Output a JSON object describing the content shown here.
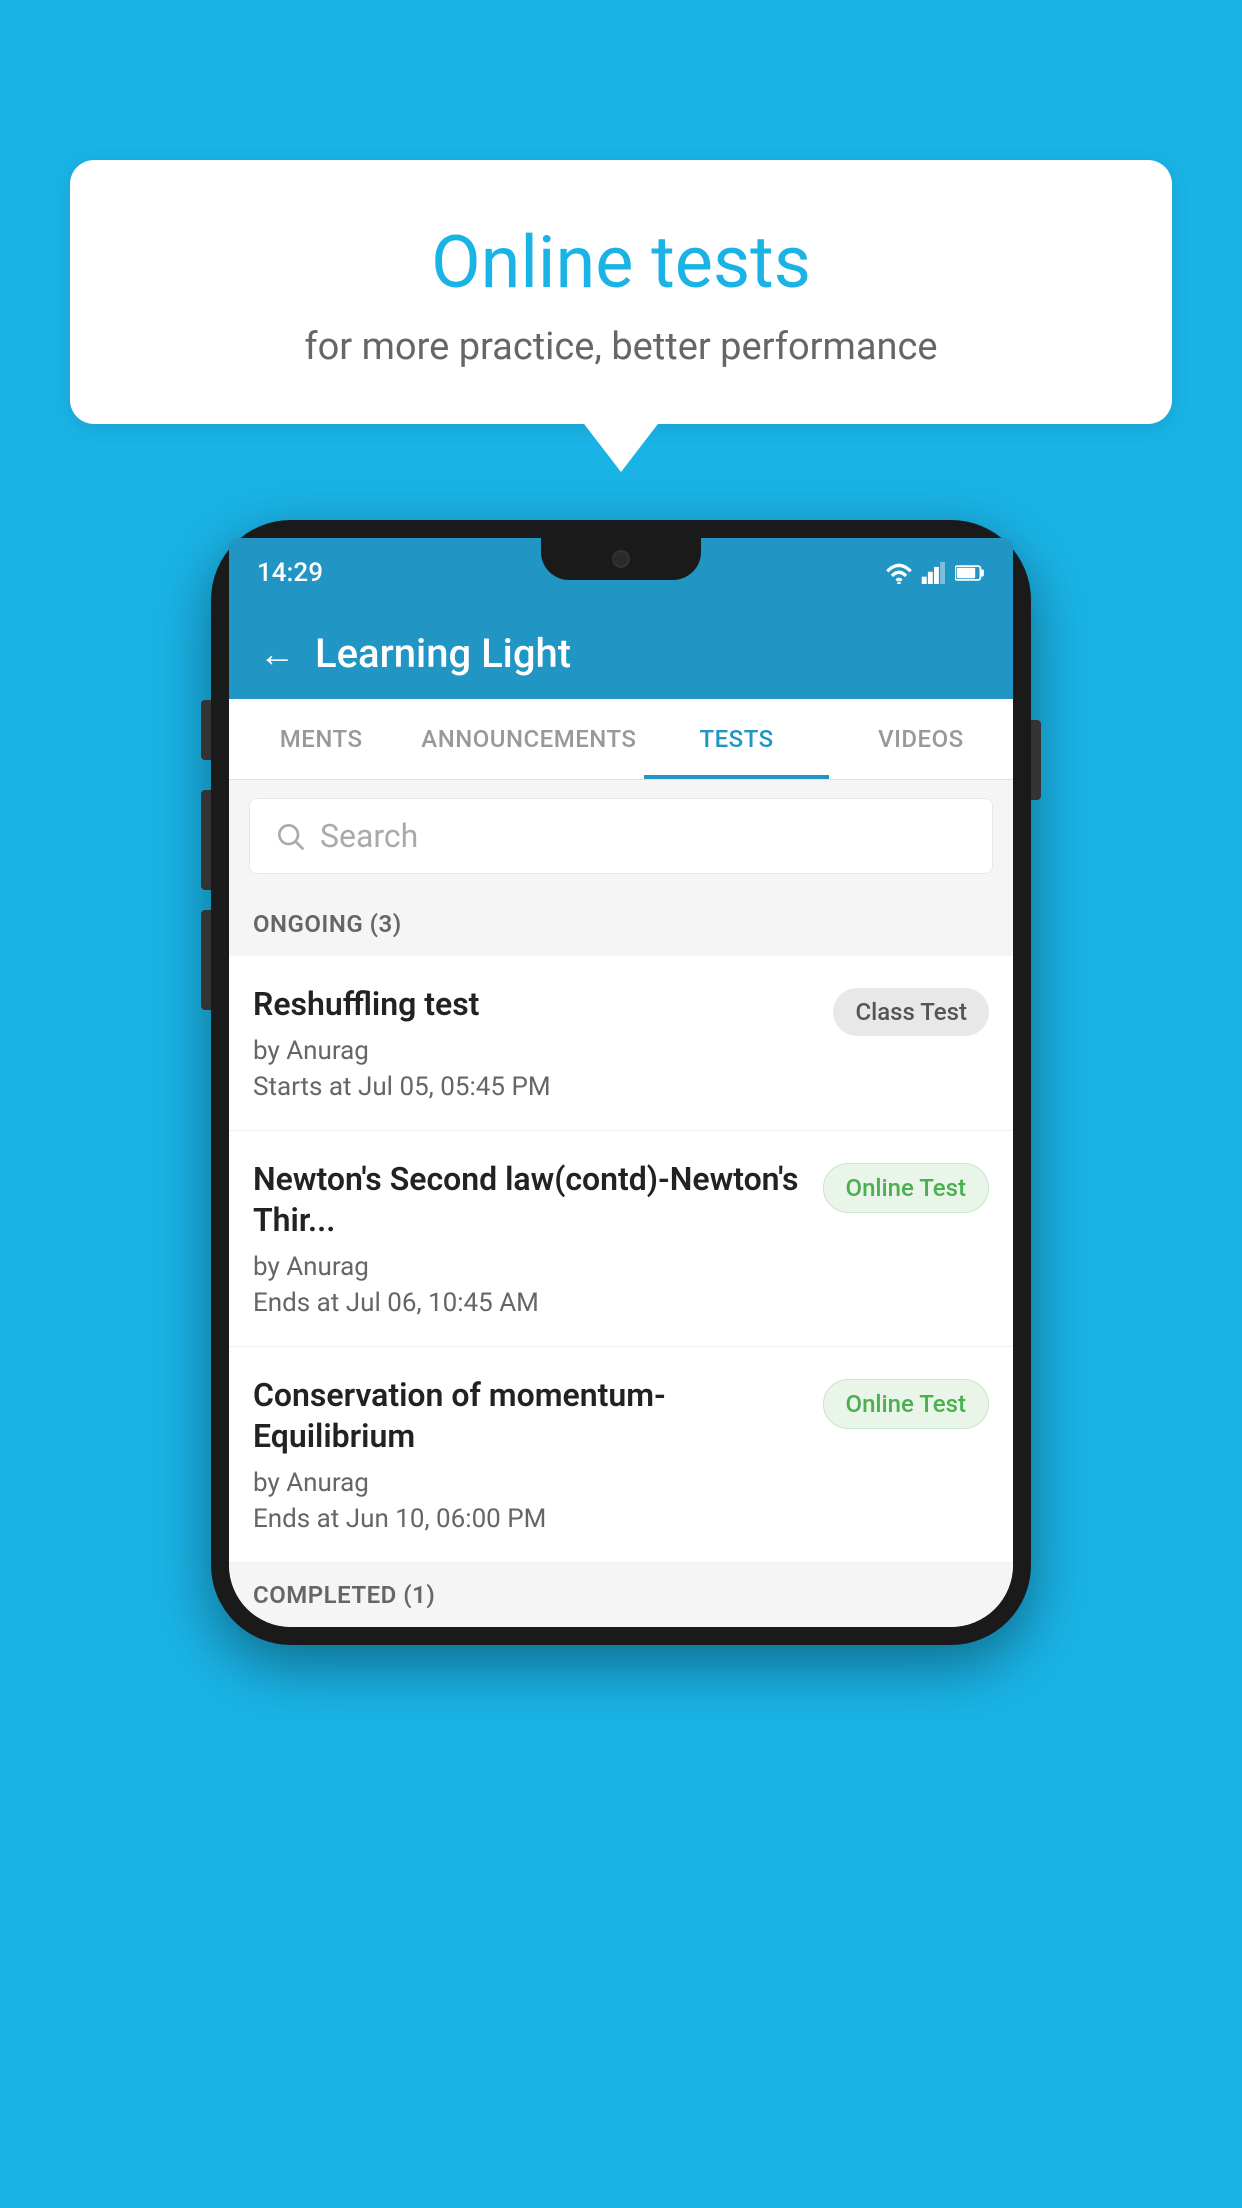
{
  "background": {
    "color": "#1ab3e6"
  },
  "speech_bubble": {
    "title": "Online tests",
    "subtitle": "for more practice, better performance"
  },
  "phone": {
    "status_bar": {
      "time": "14:29"
    },
    "app_header": {
      "title": "Learning Light",
      "back_label": "←"
    },
    "tabs": [
      {
        "label": "MENTS",
        "active": false
      },
      {
        "label": "ANNOUNCEMENTS",
        "active": false
      },
      {
        "label": "TESTS",
        "active": true
      },
      {
        "label": "VIDEOS",
        "active": false
      }
    ],
    "search": {
      "placeholder": "Search"
    },
    "ongoing_section": {
      "label": "ONGOING (3)"
    },
    "tests": [
      {
        "name": "Reshuffling test",
        "author": "by Anurag",
        "date": "Starts at  Jul 05, 05:45 PM",
        "badge": "Class Test",
        "badge_type": "class"
      },
      {
        "name": "Newton's Second law(contd)-Newton's Thir...",
        "author": "by Anurag",
        "date": "Ends at  Jul 06, 10:45 AM",
        "badge": "Online Test",
        "badge_type": "online"
      },
      {
        "name": "Conservation of momentum-Equilibrium",
        "author": "by Anurag",
        "date": "Ends at  Jun 10, 06:00 PM",
        "badge": "Online Test",
        "badge_type": "online"
      }
    ],
    "completed_section": {
      "label": "COMPLETED (1)"
    }
  }
}
